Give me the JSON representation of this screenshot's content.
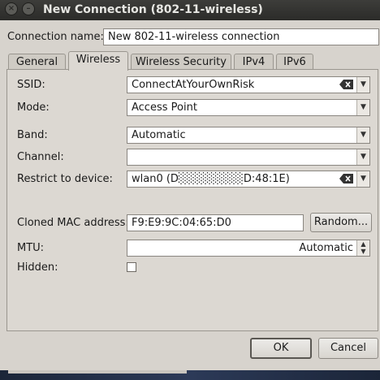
{
  "window": {
    "title": "New Connection (802-11-wireless)"
  },
  "connection_name": {
    "label": "Connection name:",
    "value": "New 802-11-wireless connection"
  },
  "tabs": [
    {
      "label": "General"
    },
    {
      "label": "Wireless"
    },
    {
      "label": "Wireless Security"
    },
    {
      "label": "IPv4"
    },
    {
      "label": "IPv6"
    }
  ],
  "active_tab": "Wireless",
  "wireless": {
    "ssid": {
      "label": "SSID:",
      "value": "ConnectAtYourOwnRisk"
    },
    "mode": {
      "label": "Mode:",
      "value": "Access Point"
    },
    "band": {
      "label": "Band:",
      "value": "Automatic"
    },
    "channel": {
      "label": "Channel:",
      "value": ""
    },
    "restrict": {
      "label": "Restrict to device:",
      "value": "wlan0 (D░░░░░░░░D:48:1E)"
    },
    "cloned_mac": {
      "label": "Cloned MAC address:",
      "value": "F9:E9:9C:04:65:D0",
      "random_label": "Random..."
    },
    "mtu": {
      "label": "MTU:",
      "value": "Automatic"
    },
    "hidden": {
      "label": "Hidden:",
      "checked": false
    }
  },
  "buttons": {
    "ok": "OK",
    "cancel": "Cancel"
  },
  "icons": {
    "close": "close-icon",
    "minimize": "minimize-icon",
    "dropdown": "chevron-down-icon",
    "clear": "backspace-clear-icon",
    "spin": "spin-arrows-icon"
  }
}
